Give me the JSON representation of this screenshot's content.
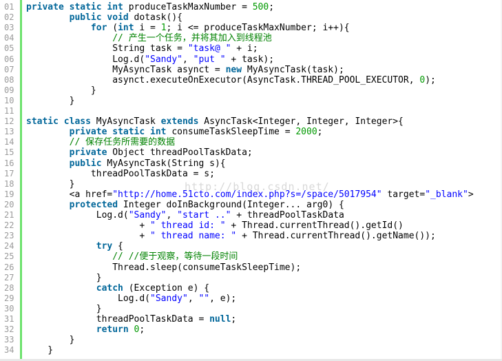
{
  "watermark": "http://blog.csdn.net/",
  "colors": {
    "keyword": "#006699",
    "string": "#0000ff",
    "number": "#009900",
    "comment": "#008200",
    "line_number": "#9a9a9a",
    "gutter_bar": "#6ce26c"
  },
  "lines": [
    {
      "num": "01",
      "tokens": [
        [
          "kw",
          "private static int"
        ],
        [
          "pl",
          " produceTaskMaxNumber = "
        ],
        [
          "num",
          "500"
        ],
        [
          "pl",
          ";"
        ]
      ]
    },
    {
      "num": "02",
      "tokens": [
        [
          "pl",
          "        "
        ],
        [
          "kw",
          "public void"
        ],
        [
          "pl",
          " dotask(){"
        ]
      ]
    },
    {
      "num": "03",
      "tokens": [
        [
          "pl",
          "            "
        ],
        [
          "kw",
          "for"
        ],
        [
          "pl",
          " ("
        ],
        [
          "kw",
          "int"
        ],
        [
          "pl",
          " i = "
        ],
        [
          "num",
          "1"
        ],
        [
          "pl",
          "; i <= produceTaskMaxNumber; i++){"
        ]
      ]
    },
    {
      "num": "04",
      "tokens": [
        [
          "pl",
          "                "
        ],
        [
          "cmt",
          "// 产生一个任务，并将其加入到线程池"
        ]
      ]
    },
    {
      "num": "05",
      "tokens": [
        [
          "pl",
          "                String task = "
        ],
        [
          "str",
          "\"task@ \""
        ],
        [
          "pl",
          " + i;"
        ]
      ]
    },
    {
      "num": "06",
      "tokens": [
        [
          "pl",
          "                Log.d("
        ],
        [
          "str",
          "\"Sandy\""
        ],
        [
          "pl",
          ", "
        ],
        [
          "str",
          "\"put \""
        ],
        [
          "pl",
          " + task);"
        ]
      ]
    },
    {
      "num": "07",
      "tokens": [
        [
          "pl",
          "                MyAsyncTask asynct = "
        ],
        [
          "kw",
          "new"
        ],
        [
          "pl",
          " MyAsyncTask(task);"
        ]
      ]
    },
    {
      "num": "08",
      "tokens": [
        [
          "pl",
          "                asynct.executeOnExecutor(AsyncTask.THREAD_POOL_EXECUTOR, "
        ],
        [
          "num",
          "0"
        ],
        [
          "pl",
          ");"
        ]
      ]
    },
    {
      "num": "09",
      "tokens": [
        [
          "pl",
          "            }"
        ]
      ]
    },
    {
      "num": "10",
      "tokens": [
        [
          "pl",
          "        }"
        ]
      ]
    },
    {
      "num": "11",
      "tokens": []
    },
    {
      "num": "12",
      "tokens": [
        [
          "kw",
          "static class"
        ],
        [
          "pl",
          " MyAsyncTask "
        ],
        [
          "kw",
          "extends"
        ],
        [
          "pl",
          " AsyncTask<Integer, Integer, Integer>{"
        ]
      ]
    },
    {
      "num": "13",
      "tokens": [
        [
          "pl",
          "        "
        ],
        [
          "kw",
          "private static int"
        ],
        [
          "pl",
          " consumeTaskSleepTime = "
        ],
        [
          "num",
          "2000"
        ],
        [
          "pl",
          ";"
        ]
      ]
    },
    {
      "num": "14",
      "tokens": [
        [
          "pl",
          "        "
        ],
        [
          "cmt",
          "// 保存任务所需要的数据"
        ]
      ]
    },
    {
      "num": "15",
      "tokens": [
        [
          "pl",
          "        "
        ],
        [
          "kw",
          "private"
        ],
        [
          "pl",
          " Object threadPoolTaskData;"
        ]
      ]
    },
    {
      "num": "16",
      "tokens": [
        [
          "pl",
          "        "
        ],
        [
          "kw",
          "public"
        ],
        [
          "pl",
          " MyAsyncTask(String s){"
        ]
      ]
    },
    {
      "num": "17",
      "tokens": [
        [
          "pl",
          "            threadPoolTaskData = s;"
        ]
      ]
    },
    {
      "num": "18",
      "tokens": [
        [
          "pl",
          "        }"
        ]
      ]
    },
    {
      "num": "19",
      "tokens": [
        [
          "pl",
          "        <a href="
        ],
        [
          "url",
          "\"http://home.51cto.com/index.php?s=/space/5017954\""
        ],
        [
          "pl",
          " target="
        ],
        [
          "url",
          "\"_blank\""
        ],
        [
          "pl",
          ">"
        ]
      ]
    },
    {
      "num": "20",
      "tokens": [
        [
          "pl",
          "        "
        ],
        [
          "kw",
          "protected"
        ],
        [
          "pl",
          " Integer doInBackground(Integer... arg0) {"
        ]
      ]
    },
    {
      "num": "21",
      "tokens": [
        [
          "pl",
          "             Log.d("
        ],
        [
          "str",
          "\"Sandy\""
        ],
        [
          "pl",
          ", "
        ],
        [
          "str",
          "\"start ..\""
        ],
        [
          "pl",
          " + threadPoolTaskData"
        ]
      ]
    },
    {
      "num": "22",
      "tokens": [
        [
          "pl",
          "                     + "
        ],
        [
          "str",
          "\" thread id: \""
        ],
        [
          "pl",
          " + Thread.currentThread().getId()"
        ]
      ]
    },
    {
      "num": "23",
      "tokens": [
        [
          "pl",
          "                     + "
        ],
        [
          "str",
          "\" thread name: \""
        ],
        [
          "pl",
          " + Thread.currentThread().getName());"
        ]
      ]
    },
    {
      "num": "24",
      "tokens": [
        [
          "pl",
          "             "
        ],
        [
          "kw",
          "try"
        ],
        [
          "pl",
          " {"
        ]
      ]
    },
    {
      "num": "25",
      "tokens": [
        [
          "pl",
          "                "
        ],
        [
          "cmt",
          "// //便于观察，等待一段时间"
        ]
      ]
    },
    {
      "num": "26",
      "tokens": [
        [
          "pl",
          "                Thread.sleep(consumeTaskSleepTime);"
        ]
      ]
    },
    {
      "num": "27",
      "tokens": [
        [
          "pl",
          "             }"
        ]
      ]
    },
    {
      "num": "28",
      "tokens": [
        [
          "pl",
          "             "
        ],
        [
          "kw",
          "catch"
        ],
        [
          "pl",
          " (Exception e) {"
        ]
      ]
    },
    {
      "num": "29",
      "tokens": [
        [
          "pl",
          "                 Log.d("
        ],
        [
          "str",
          "\"Sandy\""
        ],
        [
          "pl",
          ", "
        ],
        [
          "str",
          "\"\""
        ],
        [
          "pl",
          ", e);"
        ]
      ]
    },
    {
      "num": "30",
      "tokens": [
        [
          "pl",
          "             }"
        ]
      ]
    },
    {
      "num": "31",
      "tokens": [
        [
          "pl",
          "             threadPoolTaskData = "
        ],
        [
          "kw",
          "null"
        ],
        [
          "pl",
          ";"
        ]
      ]
    },
    {
      "num": "32",
      "tokens": [
        [
          "pl",
          "             "
        ],
        [
          "kw",
          "return"
        ],
        [
          "pl",
          " "
        ],
        [
          "num",
          "0"
        ],
        [
          "pl",
          ";"
        ]
      ]
    },
    {
      "num": "33",
      "tokens": [
        [
          "pl",
          "        }"
        ]
      ]
    },
    {
      "num": "34",
      "tokens": [
        [
          "pl",
          "    }"
        ]
      ]
    }
  ]
}
